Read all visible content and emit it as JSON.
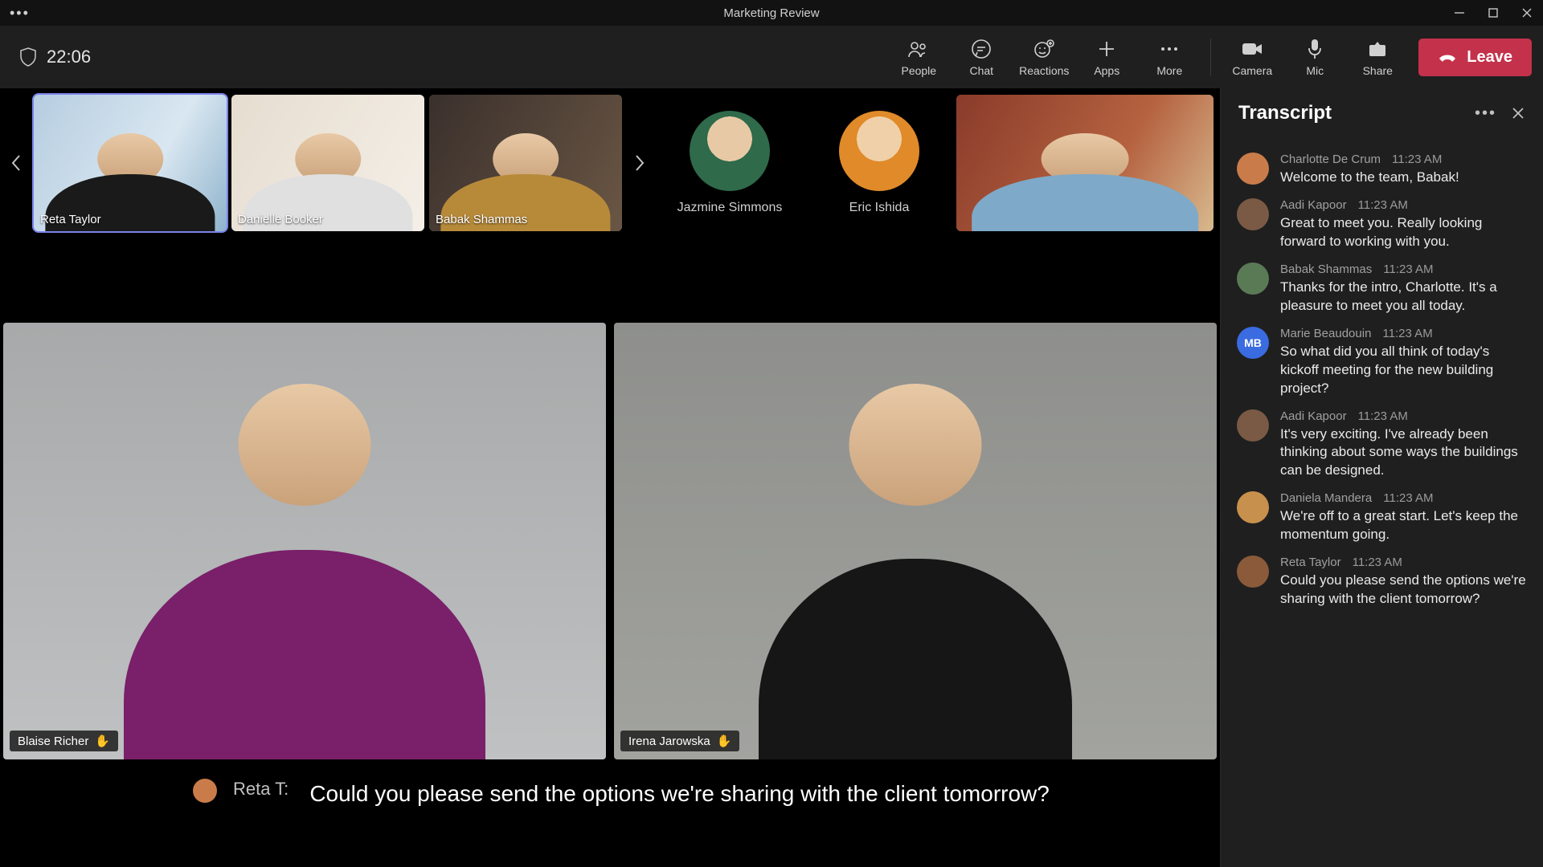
{
  "window": {
    "title": "Marketing Review"
  },
  "topbar": {
    "timer": "22:06",
    "actions": [
      "People",
      "Chat",
      "Reactions",
      "Apps",
      "More",
      "Camera",
      "Mic",
      "Share"
    ],
    "leave": "Leave"
  },
  "thumbs": [
    {
      "name": "Reta Taylor"
    },
    {
      "name": "Danielle Booker"
    },
    {
      "name": "Babak Shammas"
    }
  ],
  "avatars": [
    {
      "name": "Jazmine Simmons"
    },
    {
      "name": "Eric Ishida"
    }
  ],
  "big": [
    {
      "name": "Blaise Richer"
    },
    {
      "name": "Irena Jarowska"
    }
  ],
  "caption": {
    "speaker": "Reta T:",
    "text": "Could you please send the options we're sharing with the client tomorrow?"
  },
  "transcript": {
    "title": "Transcript",
    "items": [
      {
        "speaker": "Charlotte De Crum",
        "time": "11:23 AM",
        "text": "Welcome to the team, Babak!",
        "color": "#c97c4a",
        "initials": ""
      },
      {
        "speaker": "Aadi Kapoor",
        "time": "11:23 AM",
        "text": "Great to meet you. Really looking forward to working with you.",
        "color": "#7a5a44",
        "initials": ""
      },
      {
        "speaker": "Babak Shammas",
        "time": "11:23 AM",
        "text": "Thanks for the intro, Charlotte. It's a pleasure to meet you all today.",
        "color": "#5a7a56",
        "initials": ""
      },
      {
        "speaker": "Marie Beaudouin",
        "time": "11:23 AM",
        "text": "So what did you all think of today's kickoff meeting for the new building project?",
        "color": "#3a6be0",
        "initials": "MB"
      },
      {
        "speaker": "Aadi Kapoor",
        "time": "11:23 AM",
        "text": "It's very exciting. I've already been thinking about some ways the buildings can be designed.",
        "color": "#7a5a44",
        "initials": ""
      },
      {
        "speaker": "Daniela Mandera",
        "time": "11:23 AM",
        "text": "We're off to a great start. Let's keep the momentum going.",
        "color": "#c7904c",
        "initials": ""
      },
      {
        "speaker": "Reta Taylor",
        "time": "11:23 AM",
        "text": "Could you please send the options we're sharing with the client tomorrow?",
        "color": "#8a5a3a",
        "initials": ""
      }
    ]
  }
}
